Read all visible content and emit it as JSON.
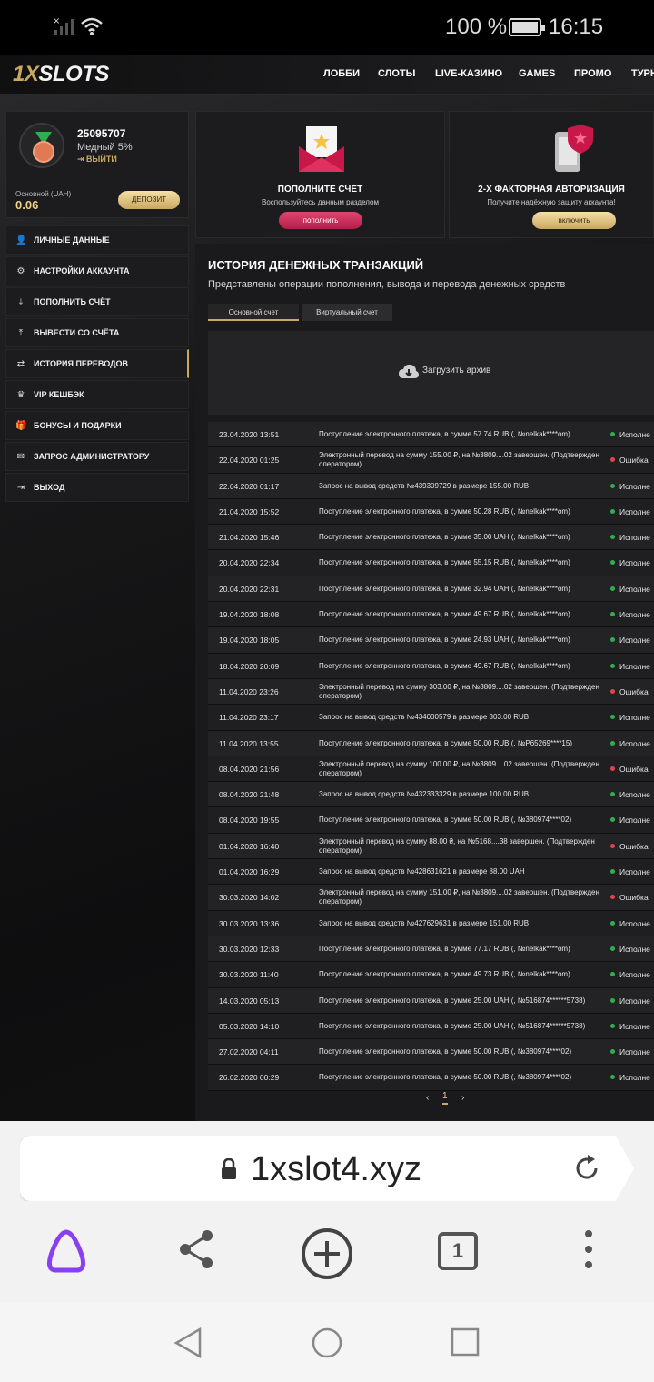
{
  "status_bar": {
    "battery_text": "100 %",
    "time": "16:15"
  },
  "site": {
    "logo": {
      "part1": "1X",
      "part2": "SLOTS"
    },
    "nav": [
      "ЛОББИ",
      "СЛОТЫ",
      "LIVE-КАЗИНО",
      "GAMES",
      "ПРОМО",
      "ТУРН"
    ],
    "profile": {
      "id": "25095707",
      "rank": "Медный 5%",
      "logout": "ВЫЙТИ",
      "balance_label": "Основной (UAH)",
      "balance": "0.06",
      "deposit_label": "ДЕПОЗИТ"
    },
    "menu": [
      {
        "icon": "user-plus-icon",
        "glyph": "👤",
        "label": "ЛИЧНЫЕ ДАННЫЕ"
      },
      {
        "icon": "gears-icon",
        "glyph": "⚙",
        "label": "НАСТРОЙКИ АККАУНТА"
      },
      {
        "icon": "download-icon",
        "glyph": "⤓",
        "label": "ПОПОЛНИТЬ СЧЁТ"
      },
      {
        "icon": "upload-icon",
        "glyph": "⤒",
        "label": "ВЫВЕСТИ СО СЧЁТА"
      },
      {
        "icon": "exchange-icon",
        "glyph": "⇄",
        "label": "ИСТОРИЯ ПЕРЕВОДОВ"
      },
      {
        "icon": "crown-icon",
        "glyph": "♛",
        "label": "VIP КЕШБЭК"
      },
      {
        "icon": "gift-icon",
        "glyph": "🎁",
        "label": "БОНУСЫ И ПОДАРКИ"
      },
      {
        "icon": "envelope-icon",
        "glyph": "✉",
        "label": "ЗАПРОС АДМИНИСТРАТОРУ"
      },
      {
        "icon": "sign-out-icon",
        "glyph": "⇥",
        "label": "ВЫХОД"
      }
    ],
    "cards": {
      "deposit": {
        "title": "ПОПОЛНИТЕ СЧЕТ",
        "subtitle": "Воспользуйтесь данным разделом",
        "button": "пополнить"
      },
      "two_factor": {
        "title": "2-Х ФАКТОРНАЯ АВТОРИЗАЦИЯ",
        "subtitle": "Получите надёжную защиту аккаунта!",
        "button": "включить"
      }
    },
    "history": {
      "title": "ИСТОРИЯ ДЕНЕЖНЫХ ТРАНЗАКЦИЙ",
      "description": "Представлены операции пополнения, вывода и перевода денежных средств",
      "tabs": [
        "Основной счет",
        "Виртуальный счет"
      ],
      "archive_label": "Загрузить архив",
      "success_color": "#2db04f",
      "error_color": "#e0454f",
      "transactions": [
        {
          "date": "23.04.2020 13:51",
          "text": "Поступление электронного платежа, в сумме 57.74 RUB (, №nelkak****om)",
          "status": "Исполне",
          "type": "ok"
        },
        {
          "date": "22.04.2020 01:25",
          "text": "Электронный перевод на сумму 155.00 ₽, на №3809....02 завершен. (Подтвержден оператором)",
          "status": "Ошибка",
          "type": "err"
        },
        {
          "date": "22.04.2020 01:17",
          "text": "Запрос на вывод средств №439309729 в размере 155.00 RUB",
          "status": "Исполне",
          "type": "ok"
        },
        {
          "date": "21.04.2020 15:52",
          "text": "Поступление электронного платежа, в сумме 50.28 RUB (, №nelkak****om)",
          "status": "Исполне",
          "type": "ok"
        },
        {
          "date": "21.04.2020 15:46",
          "text": "Поступление электронного платежа, в сумме 35.00 UAH (, №nelkak****om)",
          "status": "Исполне",
          "type": "ok"
        },
        {
          "date": "20.04.2020 22:34",
          "text": "Поступление электронного платежа, в сумме 55.15 RUB (, №nelkak****om)",
          "status": "Исполне",
          "type": "ok"
        },
        {
          "date": "20.04.2020 22:31",
          "text": "Поступление электронного платежа, в сумме 32.94 UAH (, №nelkak****om)",
          "status": "Исполне",
          "type": "ok"
        },
        {
          "date": "19.04.2020 18:08",
          "text": "Поступление электронного платежа, в сумме 49.67 RUB (, №nelkak****om)",
          "status": "Исполне",
          "type": "ok"
        },
        {
          "date": "19.04.2020 18:05",
          "text": "Поступление электронного платежа, в сумме 24.93 UAH (, №nelkak****om)",
          "status": "Исполне",
          "type": "ok"
        },
        {
          "date": "18.04.2020 20:09",
          "text": "Поступление электронного платежа, в сумме 49.67 RUB (, №nelkak****om)",
          "status": "Исполне",
          "type": "ok"
        },
        {
          "date": "11.04.2020 23:26",
          "text": "Электронный перевод на сумму 303.00 ₽, на №3809....02 завершен. (Подтвержден оператором)",
          "status": "Ошибка",
          "type": "err"
        },
        {
          "date": "11.04.2020 23:17",
          "text": "Запрос на вывод средств №434000579 в размере 303.00 RUB",
          "status": "Исполне",
          "type": "ok"
        },
        {
          "date": "11.04.2020 13:55",
          "text": "Поступление электронного платежа, в сумме 50.00 RUB (, №P65269****15)",
          "status": "Исполне",
          "type": "ok"
        },
        {
          "date": "08.04.2020 21:56",
          "text": "Электронный перевод на сумму 100.00 ₽, на №3809....02 завершен. (Подтвержден оператором)",
          "status": "Ошибка",
          "type": "err"
        },
        {
          "date": "08.04.2020 21:48",
          "text": "Запрос на вывод средств №432333329 в размере 100.00 RUB",
          "status": "Исполне",
          "type": "ok"
        },
        {
          "date": "08.04.2020 19:55",
          "text": "Поступление электронного платежа, в сумме 50.00 RUB (, №380974****02)",
          "status": "Исполне",
          "type": "ok"
        },
        {
          "date": "01.04.2020 16:40",
          "text": "Электронный перевод на сумму 88.00 ₴, на №5168....38 завершен. (Подтвержден оператором)",
          "status": "Ошибка",
          "type": "err"
        },
        {
          "date": "01.04.2020 16:29",
          "text": "Запрос на вывод средств №428631621 в размере 88.00 UAH",
          "status": "Исполне",
          "type": "ok"
        },
        {
          "date": "30.03.2020 14:02",
          "text": "Электронный перевод на сумму 151.00 ₽, на №3809....02 завершен. (Подтвержден оператором)",
          "status": "Ошибка",
          "type": "err"
        },
        {
          "date": "30.03.2020 13:36",
          "text": "Запрос на вывод средств №427629631 в размере 151.00 RUB",
          "status": "Исполне",
          "type": "ok"
        },
        {
          "date": "30.03.2020 12:33",
          "text": "Поступление электронного платежа, в сумме 77.17 RUB (, №nelkak****om)",
          "status": "Исполне",
          "type": "ok"
        },
        {
          "date": "30.03.2020 11:40",
          "text": "Поступление электронного платежа, в сумме 49.73 RUB (, №nelkak****om)",
          "status": "Исполне",
          "type": "ok"
        },
        {
          "date": "14.03.2020 05:13",
          "text": "Поступление электронного платежа, в сумме 25.00 UAH (, №516874******5738)",
          "status": "Исполне",
          "type": "ok"
        },
        {
          "date": "05.03.2020 14:10",
          "text": "Поступление электронного платежа, в сумме 25.00 UAH (, №516874******5738)",
          "status": "Исполне",
          "type": "ok"
        },
        {
          "date": "27.02.2020 04:11",
          "text": "Поступление электронного платежа, в сумме 50.00 RUB (, №380974****02)",
          "status": "Исполне",
          "type": "ok"
        },
        {
          "date": "26.02.2020 00:29",
          "text": "Поступление электронного платежа, в сумме 50.00 RUB (, №380974****02)",
          "status": "Исполне",
          "type": "ok"
        }
      ],
      "pager": {
        "prev": "‹",
        "page": "1",
        "next": "›"
      }
    }
  },
  "browser": {
    "url": "1xslot4.xyz",
    "tab_count": "1"
  }
}
